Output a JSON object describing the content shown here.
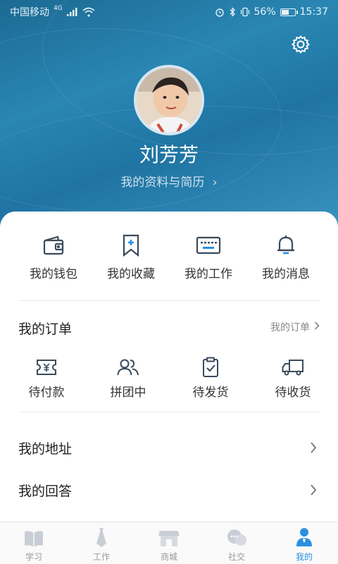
{
  "status_bar": {
    "carrier": "中国移动",
    "network": "4G",
    "battery": "56%",
    "battery_level": 0.56,
    "time": "15:37"
  },
  "profile": {
    "name": "刘芳芳",
    "link_label": "我的资料与简历",
    "link_chevron": "›"
  },
  "quick_actions": [
    {
      "label": "我的钱包",
      "icon": "wallet-icon"
    },
    {
      "label": "我的收藏",
      "icon": "bookmark-icon"
    },
    {
      "label": "我的工作",
      "icon": "keyboard-icon"
    },
    {
      "label": "我的消息",
      "icon": "bell-icon"
    }
  ],
  "orders": {
    "title": "我的订单",
    "link_label": "我的订单",
    "items": [
      {
        "label": "待付款",
        "icon": "payment-ticket-icon"
      },
      {
        "label": "拼团中",
        "icon": "group-users-icon"
      },
      {
        "label": "待发货",
        "icon": "clipboard-check-icon"
      },
      {
        "label": "待收货",
        "icon": "delivery-truck-icon"
      }
    ]
  },
  "list_rows": [
    {
      "label": "我的地址"
    },
    {
      "label": "我的回答"
    }
  ],
  "tabbar": {
    "tabs": [
      {
        "label": "学习",
        "icon": "book-icon",
        "active": false
      },
      {
        "label": "工作",
        "icon": "tie-icon",
        "active": false
      },
      {
        "label": "商城",
        "icon": "store-icon",
        "active": false
      },
      {
        "label": "社交",
        "icon": "chat-bubbles-icon",
        "active": false
      },
      {
        "label": "我的",
        "icon": "person-icon",
        "active": true
      }
    ]
  },
  "colors": {
    "accent": "#2b8fe0",
    "hero_blue": "#2a86b3",
    "icon_dark": "#3a4a5c"
  }
}
